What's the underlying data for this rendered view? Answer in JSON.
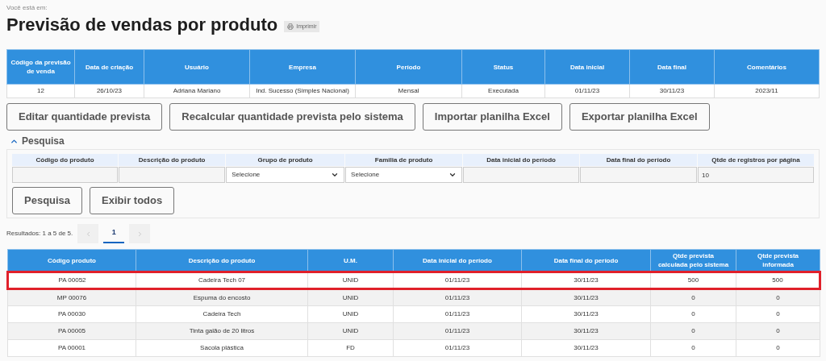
{
  "breadcrumb": "Você está em:",
  "title": "Previsão de vendas por produto",
  "print_button": "Imprimir",
  "summary": {
    "columns": [
      "Código da previsão de venda",
      "Data de criação",
      "Usuário",
      "Empresa",
      "Período",
      "Status",
      "Data inicial",
      "Data final",
      "Comentários"
    ],
    "rows": [
      [
        "12",
        "26/10/23",
        "Adriana Mariano",
        "Ind. Sucesso (Simples Nacional)",
        "Mensal",
        "Executada",
        "01/11/23",
        "30/11/23",
        "2023/11"
      ]
    ]
  },
  "actions": [
    "Editar quantidade prevista",
    "Recalcular quantidade prevista pelo sistema",
    "Importar planilha Excel",
    "Exportar planilha Excel"
  ],
  "search": {
    "title": "Pesquisa",
    "expanded": true,
    "fields": [
      {
        "label": "Código do produto",
        "kind": "text"
      },
      {
        "label": "Descrição do produto",
        "kind": "text"
      },
      {
        "label": "Grupo de produto",
        "kind": "select",
        "value": "Selecione"
      },
      {
        "label": "Familia de produto",
        "kind": "select",
        "value": "Selecione"
      },
      {
        "label": "Data inicial do período",
        "kind": "text"
      },
      {
        "label": "Data final do período",
        "kind": "text"
      },
      {
        "label": "Qtde de registros por página",
        "kind": "text",
        "value": "10"
      }
    ],
    "buttons": [
      "Pesquisa",
      "Exibir todos"
    ]
  },
  "results": {
    "summary": "Resultados: 1 a 5 de 5.",
    "pages": [
      {
        "label": "1",
        "selected": true
      }
    ],
    "columns": [
      "Código produto",
      "Descrição do produto",
      "U.M.",
      "Data inicial do período",
      "Data final do período",
      "Qtde prevista calculada pelo sistema",
      "Qtde prevista informada"
    ],
    "rows": [
      {
        "highlighted": true,
        "cells": [
          "PA 00052",
          "Cadeira Tech 07",
          "UNID",
          "01/11/23",
          "30/11/23",
          "500",
          "500"
        ]
      },
      {
        "highlighted": false,
        "cells": [
          "MP 00076",
          "Espuma do encosto",
          "UNID",
          "01/11/23",
          "30/11/23",
          "0",
          "0"
        ]
      },
      {
        "highlighted": false,
        "cells": [
          "PA 00030",
          "Cadeira Tech",
          "UNID",
          "01/11/23",
          "30/11/23",
          "0",
          "0"
        ]
      },
      {
        "highlighted": false,
        "cells": [
          "PA 00005",
          "Tinta galão de 20 litros",
          "UNID",
          "01/11/23",
          "30/11/23",
          "0",
          "0"
        ]
      },
      {
        "highlighted": false,
        "cells": [
          "PA 00001",
          "Sacola plástica",
          "FD",
          "01/11/23",
          "30/11/23",
          "0",
          "0"
        ]
      }
    ]
  }
}
